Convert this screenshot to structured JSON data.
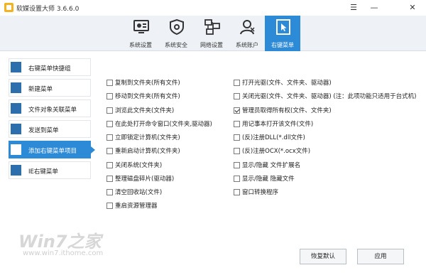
{
  "window": {
    "title": "软媒设置大师 3.6.6.0"
  },
  "nav_tabs": [
    {
      "label": "系统设置",
      "icon": "monitor-icon"
    },
    {
      "label": "系统安全",
      "icon": "shield-gear-icon"
    },
    {
      "label": "网络设置",
      "icon": "network-icon"
    },
    {
      "label": "系统账户",
      "icon": "user-icon"
    },
    {
      "label": "右键菜单",
      "icon": "cursor-icon",
      "active": true
    }
  ],
  "sidebar": {
    "items": [
      {
        "label": "右键菜单快捷组",
        "active": false
      },
      {
        "label": "新建菜单",
        "active": false
      },
      {
        "label": "文件对象关联菜单",
        "active": false
      },
      {
        "label": "发送到菜单",
        "active": false
      },
      {
        "label": "添加右键菜单项目",
        "active": true
      },
      {
        "label": "IE右键菜单",
        "active": false
      }
    ]
  },
  "options": {
    "left": [
      {
        "label": "复制到文件夹(所有文件)",
        "checked": false
      },
      {
        "label": "移动到文件夹(所有文件)",
        "checked": false
      },
      {
        "label": "浏览此文件夹(文件夹)",
        "checked": false
      },
      {
        "label": "在此处打开命令窗口(文件夹,驱动器)",
        "checked": false
      },
      {
        "label": "立即锁定计算机(文件夹)",
        "checked": false
      },
      {
        "label": "重新启动计算机(文件夹)",
        "checked": false
      },
      {
        "label": "关闭系统(文件夹)",
        "checked": false
      },
      {
        "label": "整理磁盘碎片(驱动器)",
        "checked": false
      },
      {
        "label": "清空回收站(文件)",
        "checked": false
      },
      {
        "label": "重启资源管理器",
        "checked": false
      }
    ],
    "right": [
      {
        "label": "打开光驱(文件、文件夹、驱动器)",
        "checked": false
      },
      {
        "label": "关闭光驱(文件、文件夹、驱动器) (注：此项功能只适用于台式机)",
        "checked": false
      },
      {
        "label": "管理员取得所有权(文件、文件夹)",
        "checked": true
      },
      {
        "label": "用记事本打开该文件(文件)",
        "checked": false
      },
      {
        "label": "(反)注册DLL(*.dll文件)",
        "checked": false
      },
      {
        "label": "(反)注册OCX(*.ocx文件)",
        "checked": false
      },
      {
        "label": "显示/隐藏 文件扩展名",
        "checked": false
      },
      {
        "label": "显示/隐藏 隐藏文件",
        "checked": false
      },
      {
        "label": "窗口转换程序",
        "checked": false
      }
    ]
  },
  "buttons": {
    "restore_label": "恢复默认",
    "apply_label": "应用"
  },
  "watermark": {
    "logo": "Win7之家",
    "url": "www.win7.ithome.com"
  },
  "colors": {
    "accent": "#2d8ad6",
    "sidebar_icon": "#2d6fad",
    "toolbar_bg": "#eef2f6"
  }
}
